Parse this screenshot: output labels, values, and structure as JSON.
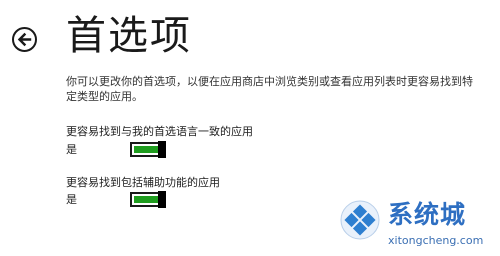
{
  "page": {
    "title": "首选项",
    "description": "你可以更改你的首选项，以便在应用商店中浏览类别或查看应用列表时更容易找到特定类型的应用。"
  },
  "settings": [
    {
      "label": "更容易找到与我的首选语言一致的应用",
      "state": "是",
      "on": true
    },
    {
      "label": "更容易找到包括辅助功能的应用",
      "state": "是",
      "on": true
    }
  ],
  "watermark": {
    "name": "系统城",
    "domain": "xitongcheng.com"
  },
  "colors": {
    "toggle_on": "#1f9d1f",
    "watermark_blue": "#2e6fc2"
  },
  "icons": {
    "back": "back-arrow-icon",
    "logo": "windows-logo-icon"
  }
}
